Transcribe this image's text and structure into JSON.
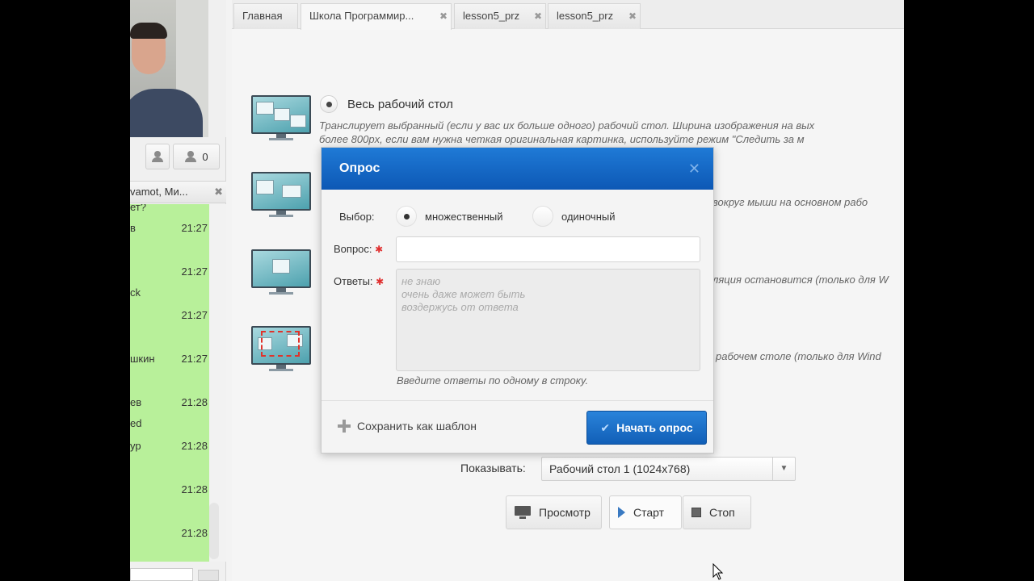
{
  "left_panel": {
    "users_count": "0",
    "chat_header": "vamot, Ми...",
    "chat_rows": [
      {
        "name": "ет?",
        "time": ""
      },
      {
        "name": "в",
        "time": "21:27"
      },
      {
        "name": "",
        "time": "21:27"
      },
      {
        "name": "ck",
        "time": ""
      },
      {
        "name": "",
        "time": "21:27"
      },
      {
        "name": "шкин",
        "time": "21:27"
      },
      {
        "name": "ев",
        "time": "21:28"
      },
      {
        "name": "ed",
        "time": ""
      },
      {
        "name": "ур",
        "time": "21:28"
      },
      {
        "name": "",
        "time": "21:28"
      },
      {
        "name": "",
        "time": "21:28"
      }
    ]
  },
  "tabs": [
    {
      "label": "Главная",
      "closable": false
    },
    {
      "label": "Школа Программир...",
      "closable": true
    },
    {
      "label": "lesson5_prz",
      "closable": true
    },
    {
      "label": "lesson5_prz",
      "closable": true
    }
  ],
  "options": [
    {
      "title": "Весь рабочий стол",
      "desc1": "Транслирует выбранный (если у вас их больше одного) рабочий стол. Ширина изображения на вых",
      "desc2": "более 800px, если вам нужна четкая оригинальная картинка, используйте режим \"Следить за м"
    },
    {
      "desc1": "вокруг мыши на основном рабо"
    },
    {
      "desc1": "ляция остановится (только для W"
    },
    {
      "desc1": "рабочем столе (только для Wind"
    }
  ],
  "show": {
    "label": "Показывать:",
    "value": "Рабочий стол 1 (1024x768)"
  },
  "actions": {
    "preview": "Просмотр",
    "start": "Старт",
    "stop": "Стоп"
  },
  "dialog": {
    "title": "Опрос",
    "choice_label": "Выбор:",
    "choice_multiple": "множественный",
    "choice_single": "одиночный",
    "selected_choice": "множественный",
    "question_label": "Вопрос:",
    "question_value": "",
    "answers_label": "Ответы:",
    "answers_placeholder": "не знаю\nочень даже может быть\nвоздержусь от ответа",
    "answers_hint": "Введите ответы по одному в строку.",
    "save_template": "Сохранить как шаблон",
    "start_poll": "Начать опрос"
  }
}
